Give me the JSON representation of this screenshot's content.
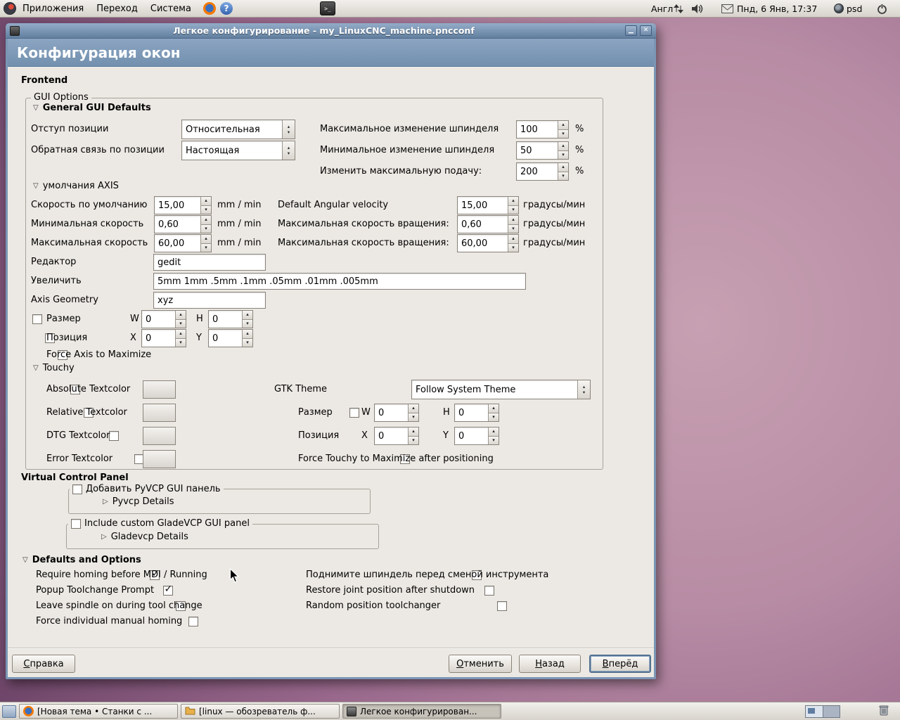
{
  "colors": {
    "titlebar": "#7b96b5",
    "header": "#7c99b8",
    "content_bg": "#ece9e4",
    "panel_bg": "#d9d5cf",
    "desktop_purple": "#9c7490",
    "swatch_black": "#000000",
    "focus_accent": "#54718f"
  },
  "icons": {
    "expander_open": "▽",
    "expander_closed": "▷",
    "spin_up": "▴",
    "spin_down": "▾",
    "check": "✓",
    "close": "✕",
    "minimize": "▁",
    "help_glyph": "?",
    "terminal_glyph": ">_"
  },
  "top_panel": {
    "menus": [
      "Приложения",
      "Переход",
      "Система"
    ],
    "language_indicator": "Англ",
    "clock": "Пнд, 6 Янв, 17:37",
    "psd_label": "psd"
  },
  "window": {
    "title": "Легкое конфигурирование - my_LinuxCNC_machine.pncconf",
    "page_title": "Конфигурация окон"
  },
  "frontend": {
    "section_label": "Frontend",
    "frame_label": "GUI Options",
    "general": {
      "expander": "General GUI Defaults",
      "position_offset_label": "Отступ позиции",
      "position_offset_value": "Относительная",
      "position_feedback_label": "Обратная связь по позиции",
      "position_feedback_value": "Настоящая",
      "spindle_max_label": "Максимальное изменение шпинделя",
      "spindle_max_value": "100",
      "spindle_min_label": "Минимальное изменение шпинделя",
      "spindle_min_value": "50",
      "feed_override_label": "Изменить максимальную подачу:",
      "feed_override_value": "200",
      "percent": "%"
    },
    "axis": {
      "expander": "умолчания AXIS",
      "rows": [
        {
          "label": "Скорость по умолчанию",
          "value": "15,00",
          "unit": "mm / min",
          "rlabel": "Default Angular velocity",
          "rvalue": "15,00",
          "runit": "градусы/мин"
        },
        {
          "label": "Минимальная скорость",
          "value": "0,60",
          "unit": "mm / min",
          "rlabel": "Максимальная скорость вращения:",
          "rvalue": "0,60",
          "runit": "градусы/мин"
        },
        {
          "label": "Максимальная скорость",
          "value": "60,00",
          "unit": "mm / min",
          "rlabel": "Максимальная скорость вращения:",
          "rvalue": "60,00",
          "runit": "градусы/мин"
        }
      ],
      "editor_label": "Редактор",
      "editor_value": "gedit",
      "increments_label": "Увеличить",
      "increments_value": "5mm 1mm .5mm .1mm .05mm .01mm .005mm",
      "geometry_label": "Axis Geometry",
      "geometry_value": "xyz",
      "size_label": "Размер",
      "size_w_label": "W",
      "size_w_value": "0",
      "size_h_label": "H",
      "size_h_value": "0",
      "pos_label": "Позиция",
      "pos_x_label": "X",
      "pos_x_value": "0",
      "pos_y_label": "Y",
      "pos_y_value": "0",
      "force_max_label": "Force Axis to Maximize"
    },
    "touchy": {
      "expander": "Touchy",
      "color_rows": [
        {
          "label": "Absolute Textcolor"
        },
        {
          "label": "Relative Textcolor"
        },
        {
          "label": "DTG Textcolor"
        },
        {
          "label": "Error Textcolor"
        }
      ],
      "gtk_theme_label": "GTK Theme",
      "gtk_theme_value": "Follow System Theme",
      "size_label": "Размер",
      "size_w_label": "W",
      "size_w_value": "0",
      "size_h_label": "H",
      "size_h_value": "0",
      "pos_label": "Позиция",
      "pos_x_label": "X",
      "pos_x_value": "0",
      "pos_y_label": "Y",
      "pos_y_value": "0",
      "force_max_label": "Force Touchy to Maximize after positioning"
    }
  },
  "vcp": {
    "section_label": "Virtual Control Panel",
    "pyvcp_check_label": "Добавить PyVCP GUI панель",
    "pyvcp_details_label": "Pyvcp Details",
    "gladevcp_check_label": "Include custom GladeVCP GUI panel",
    "gladevcp_details_label": "Gladevcp Details"
  },
  "defaults": {
    "expander": "Defaults and Options",
    "left": [
      {
        "label": "Require homing before MDI / Running",
        "checked": true
      },
      {
        "label": "Popup Toolchange Prompt",
        "checked": true
      },
      {
        "label": "Leave spindle on during tool change",
        "checked": false
      },
      {
        "label": "Force individual manual homing",
        "checked": false
      }
    ],
    "right": [
      {
        "label": "Поднимите шпиндель перед сменой инструмента",
        "checked": false
      },
      {
        "label": "Restore joint position after shutdown",
        "checked": false
      },
      {
        "label": "Random position toolchanger",
        "checked": false
      }
    ]
  },
  "actions": {
    "help": {
      "accel": "С",
      "rest": "правка"
    },
    "cancel": {
      "accel": "О",
      "rest": "тменить"
    },
    "back": {
      "accel": "Н",
      "rest": "азад"
    },
    "forward": {
      "accel": "В",
      "rest": "перёд"
    }
  },
  "taskbar": {
    "windows": [
      {
        "label": "[Новая тема • Станки с ..."
      },
      {
        "label": "[linux — обозреватель ф..."
      },
      {
        "label": "Легкое конфигурирован..."
      }
    ]
  }
}
